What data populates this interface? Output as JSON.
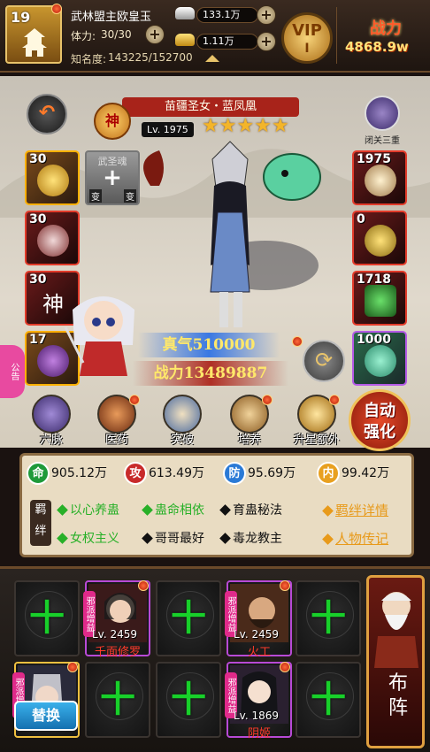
{
  "header": {
    "player_level": "19",
    "player_name": "武林盟主欧皇玉",
    "stamina_label": "体力:",
    "stamina": "30/30",
    "fame_label": "知名度:",
    "fame": "143225/152700",
    "silver": "133.1万",
    "gold": "1.11万",
    "vip_label": "VIP",
    "vip_level": "I",
    "power_label": "战力",
    "power_value": "4868.9w"
  },
  "hero": {
    "title": "苗疆圣女・蓝凤凰",
    "quality": "神",
    "level": "Lv. 1975",
    "stars": 5,
    "closed_label": "闭关三重",
    "qi": "真气510000",
    "combat": "战力13489887",
    "soul_label": "武圣魂",
    "soul_change_left": "变",
    "soul_change_right": "变",
    "announce": "公告"
  },
  "left_slots": [
    {
      "num": "30",
      "color": "#ffb000"
    },
    {
      "num": "30",
      "color": "#e23b2a"
    },
    {
      "num": "30",
      "color": "#e23b2a",
      "glyph": "神"
    },
    {
      "num": "17",
      "color": "#ffb000"
    }
  ],
  "right_slots": [
    {
      "num": "1975",
      "color": "#e23b2a"
    },
    {
      "num": "0",
      "color": "#e23b2a"
    },
    {
      "num": "1718",
      "color": "#e23b2a"
    },
    {
      "num": "1000",
      "color": "#b45ae6"
    }
  ],
  "actions": [
    "六脉",
    "医药",
    "突破",
    "培养",
    "升星额外"
  ],
  "auto_strengthen": [
    "自动",
    "强化"
  ],
  "attributes": [
    {
      "icon": "命",
      "value": "905.12万",
      "color": "#1e9a3a"
    },
    {
      "icon": "攻",
      "value": "613.49万",
      "color": "#c82a2a"
    },
    {
      "icon": "防",
      "value": "95.69万",
      "color": "#2a7ad6"
    },
    {
      "icon": "内",
      "value": "99.42万",
      "color": "#e8a020"
    }
  ],
  "bonds_label": "羁绊",
  "bonds_row1": [
    {
      "text": "以心养蛊",
      "active": true
    },
    {
      "text": "蛊命相依",
      "active": true
    },
    {
      "text": "育蛊秘法",
      "active": false
    }
  ],
  "bonds_row2": [
    {
      "text": "女权主义",
      "active": true
    },
    {
      "text": "哥哥最好",
      "active": false
    },
    {
      "text": "毒龙教主",
      "active": false
    }
  ],
  "links": [
    "羁绊详情",
    "人物传记"
  ],
  "lineup": {
    "row1": [
      {
        "type": "empty"
      },
      {
        "type": "hero",
        "tag": "邪派增益",
        "level": "Lv. 2459",
        "name": "千面修罗"
      },
      {
        "type": "empty"
      },
      {
        "type": "hero",
        "tag": "邪派增益",
        "level": "Lv. 2459",
        "name": "火工"
      },
      {
        "type": "empty"
      }
    ],
    "row2": [
      {
        "type": "hero",
        "tag": "邪派增益",
        "level": "",
        "name": ""
      },
      {
        "type": "empty"
      },
      {
        "type": "empty"
      },
      {
        "type": "hero",
        "tag": "邪派增益",
        "level": "Lv. 1869",
        "name": "阴姬"
      },
      {
        "type": "empty"
      }
    ],
    "plus": "十",
    "swap_label": "替换",
    "formation_label": [
      "布",
      "阵"
    ]
  }
}
